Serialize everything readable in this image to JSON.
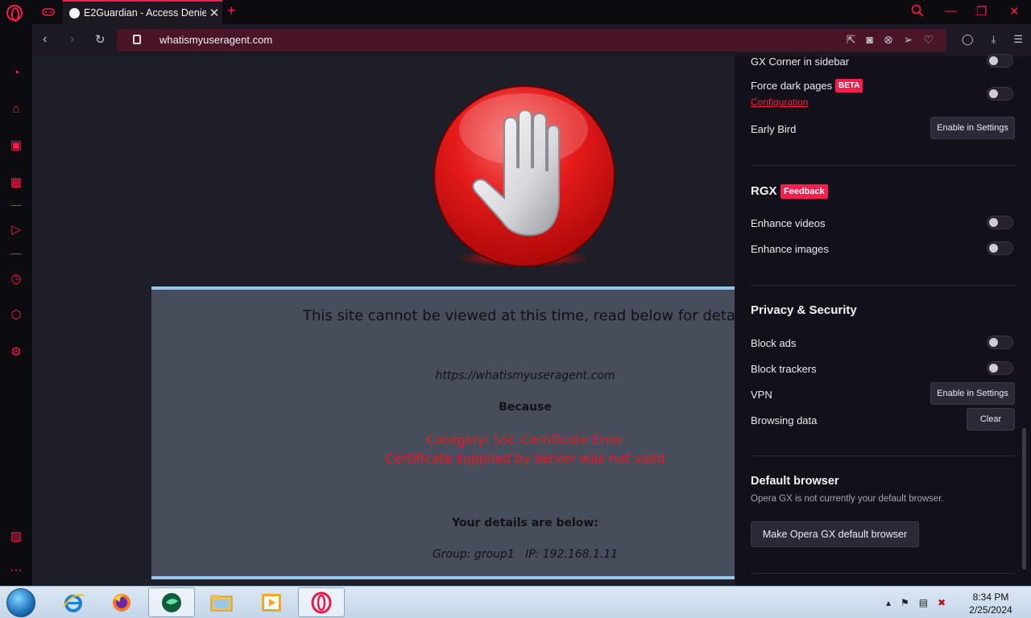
{
  "tabs": {
    "active_title": "E2Guardian - Access Denie"
  },
  "address": {
    "url": "whatismyuseragent.com"
  },
  "page": {
    "message": "This site cannot be viewed at this time, read below for details.",
    "blocked_url": "https://whatismyuseragent.com",
    "because": "Because",
    "category": "Category: SSL Certificate Error",
    "reason": "Certificate supplied by server was not valid",
    "details_heading": "Your details are below:",
    "group_ip": "Group: group1   IP: 192.168.1.11"
  },
  "panel": {
    "gx_corner": "GX Corner in sidebar",
    "force_dark": "Force dark pages",
    "beta_badge": "BETA",
    "configuration": "Configuration",
    "early_bird": "Early Bird",
    "enable_settings_1": "Enable in Settings",
    "rgx_title": "RGX",
    "feedback_badge": "Feedback",
    "enhance_videos": "Enhance videos",
    "enhance_images": "Enhance images",
    "privacy_title": "Privacy & Security",
    "block_ads": "Block ads",
    "block_trackers": "Block trackers",
    "vpn": "VPN",
    "enable_settings_2": "Enable in Settings",
    "browsing_data": "Browsing data",
    "clear": "Clear",
    "default_title": "Default browser",
    "default_note": "Opera GX is not currently your default browser.",
    "make_default": "Make Opera GX default browser"
  },
  "taskbar": {
    "time": "8:34 PM",
    "date": "2/25/2024"
  },
  "colors": {
    "accent": "#fa1e4e",
    "error_text": "#e8191f"
  }
}
